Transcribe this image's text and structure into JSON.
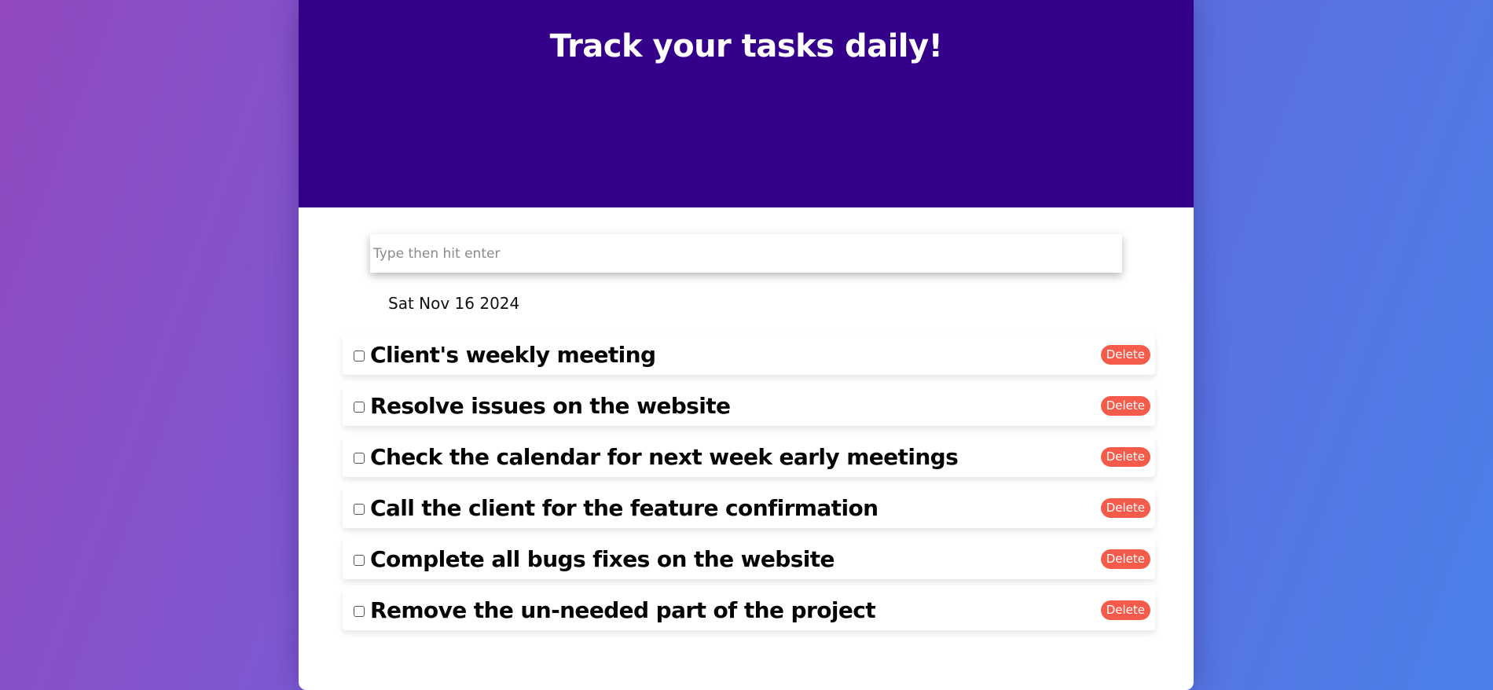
{
  "header": {
    "title": "Track your tasks daily!"
  },
  "input": {
    "placeholder": "Type then hit enter",
    "value": ""
  },
  "date": "Sat Nov 16 2024",
  "tasks": [
    {
      "text": "Client's weekly meeting",
      "checked": false,
      "delete_label": "Delete"
    },
    {
      "text": "Resolve issues on the website",
      "checked": false,
      "delete_label": "Delete"
    },
    {
      "text": "Check the calendar for next week early meetings",
      "checked": false,
      "delete_label": "Delete"
    },
    {
      "text": "Call the client for the feature confirmation",
      "checked": false,
      "delete_label": "Delete"
    },
    {
      "text": "Complete all bugs fixes on the website",
      "checked": false,
      "delete_label": "Delete"
    },
    {
      "text": "Remove the un-needed part of the project",
      "checked": false,
      "delete_label": "Delete"
    }
  ],
  "colors": {
    "header_bg": "#34008a",
    "delete_bg": "#f45b4a",
    "page_gradient_start": "#9249be",
    "page_gradient_end": "#4c80e8"
  }
}
